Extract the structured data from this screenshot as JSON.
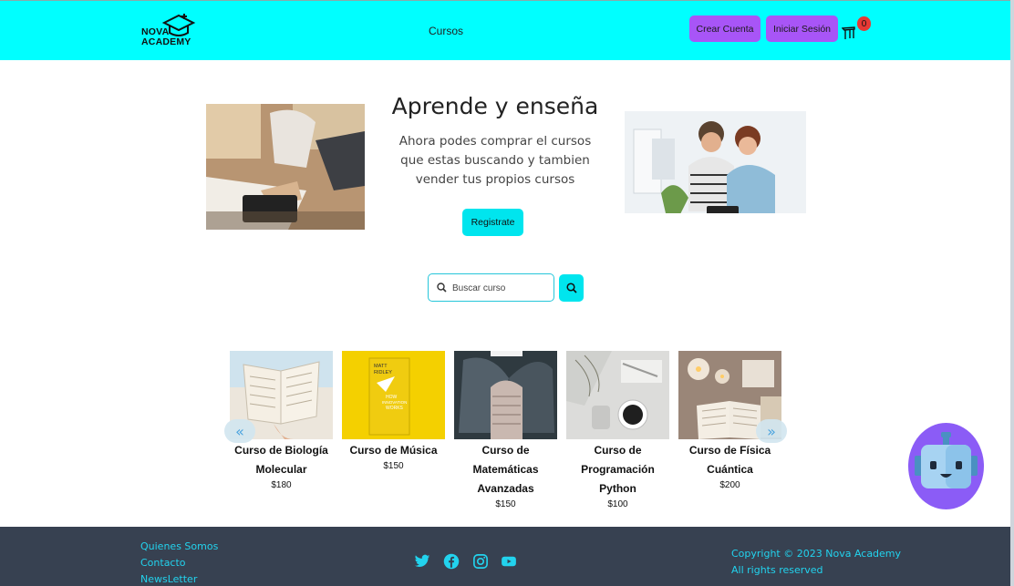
{
  "header": {
    "logo_line1": "NOVA",
    "logo_line2": "ACADEMY",
    "nav_cursos": "Cursos",
    "crear_cuenta": "Crear Cuenta",
    "iniciar_sesion": "Iniciar Sesión",
    "cart_count": "0",
    "colors": {
      "background": "#00ffff",
      "buttons": "#a855f7",
      "badge": "#e53935"
    }
  },
  "hero": {
    "title": "Aprende y enseña",
    "description": "Ahora podes comprar el cursos que estas buscando y tambien vender tus propios cursos",
    "cta": "Registrate"
  },
  "search": {
    "placeholder": "Buscar curso"
  },
  "carousel": {
    "prev": "«",
    "next": "»",
    "courses": [
      {
        "title": "Curso de Biología Molecular",
        "price": "$180",
        "image": "open-book-beach"
      },
      {
        "title": "Curso de Música",
        "price": "$150",
        "image": "yellow-book-cover"
      },
      {
        "title": "Curso de Matemáticas Avanzadas",
        "price": "$150",
        "image": "sweater-knees"
      },
      {
        "title": "Curso de Programación Python",
        "price": "$100",
        "image": "coffee-flatlay"
      },
      {
        "title": "Curso de Física Cuántica",
        "price": "$200",
        "image": "candles-book"
      }
    ],
    "book_cover_text": [
      "MATT",
      "RIDLEY",
      "HOW",
      "INNOVATION",
      "WORKS"
    ]
  },
  "footer": {
    "links": [
      "Quienes Somos",
      "Contacto",
      "NewsLetter"
    ],
    "social": [
      "twitter-icon",
      "facebook-icon",
      "instagram-icon",
      "youtube-icon"
    ],
    "copyright_line1": "Copyright © 2023 Nova Academy",
    "copyright_line2": "All rights reserved",
    "colors": {
      "background": "#374151",
      "text": "#22d3ee"
    }
  }
}
